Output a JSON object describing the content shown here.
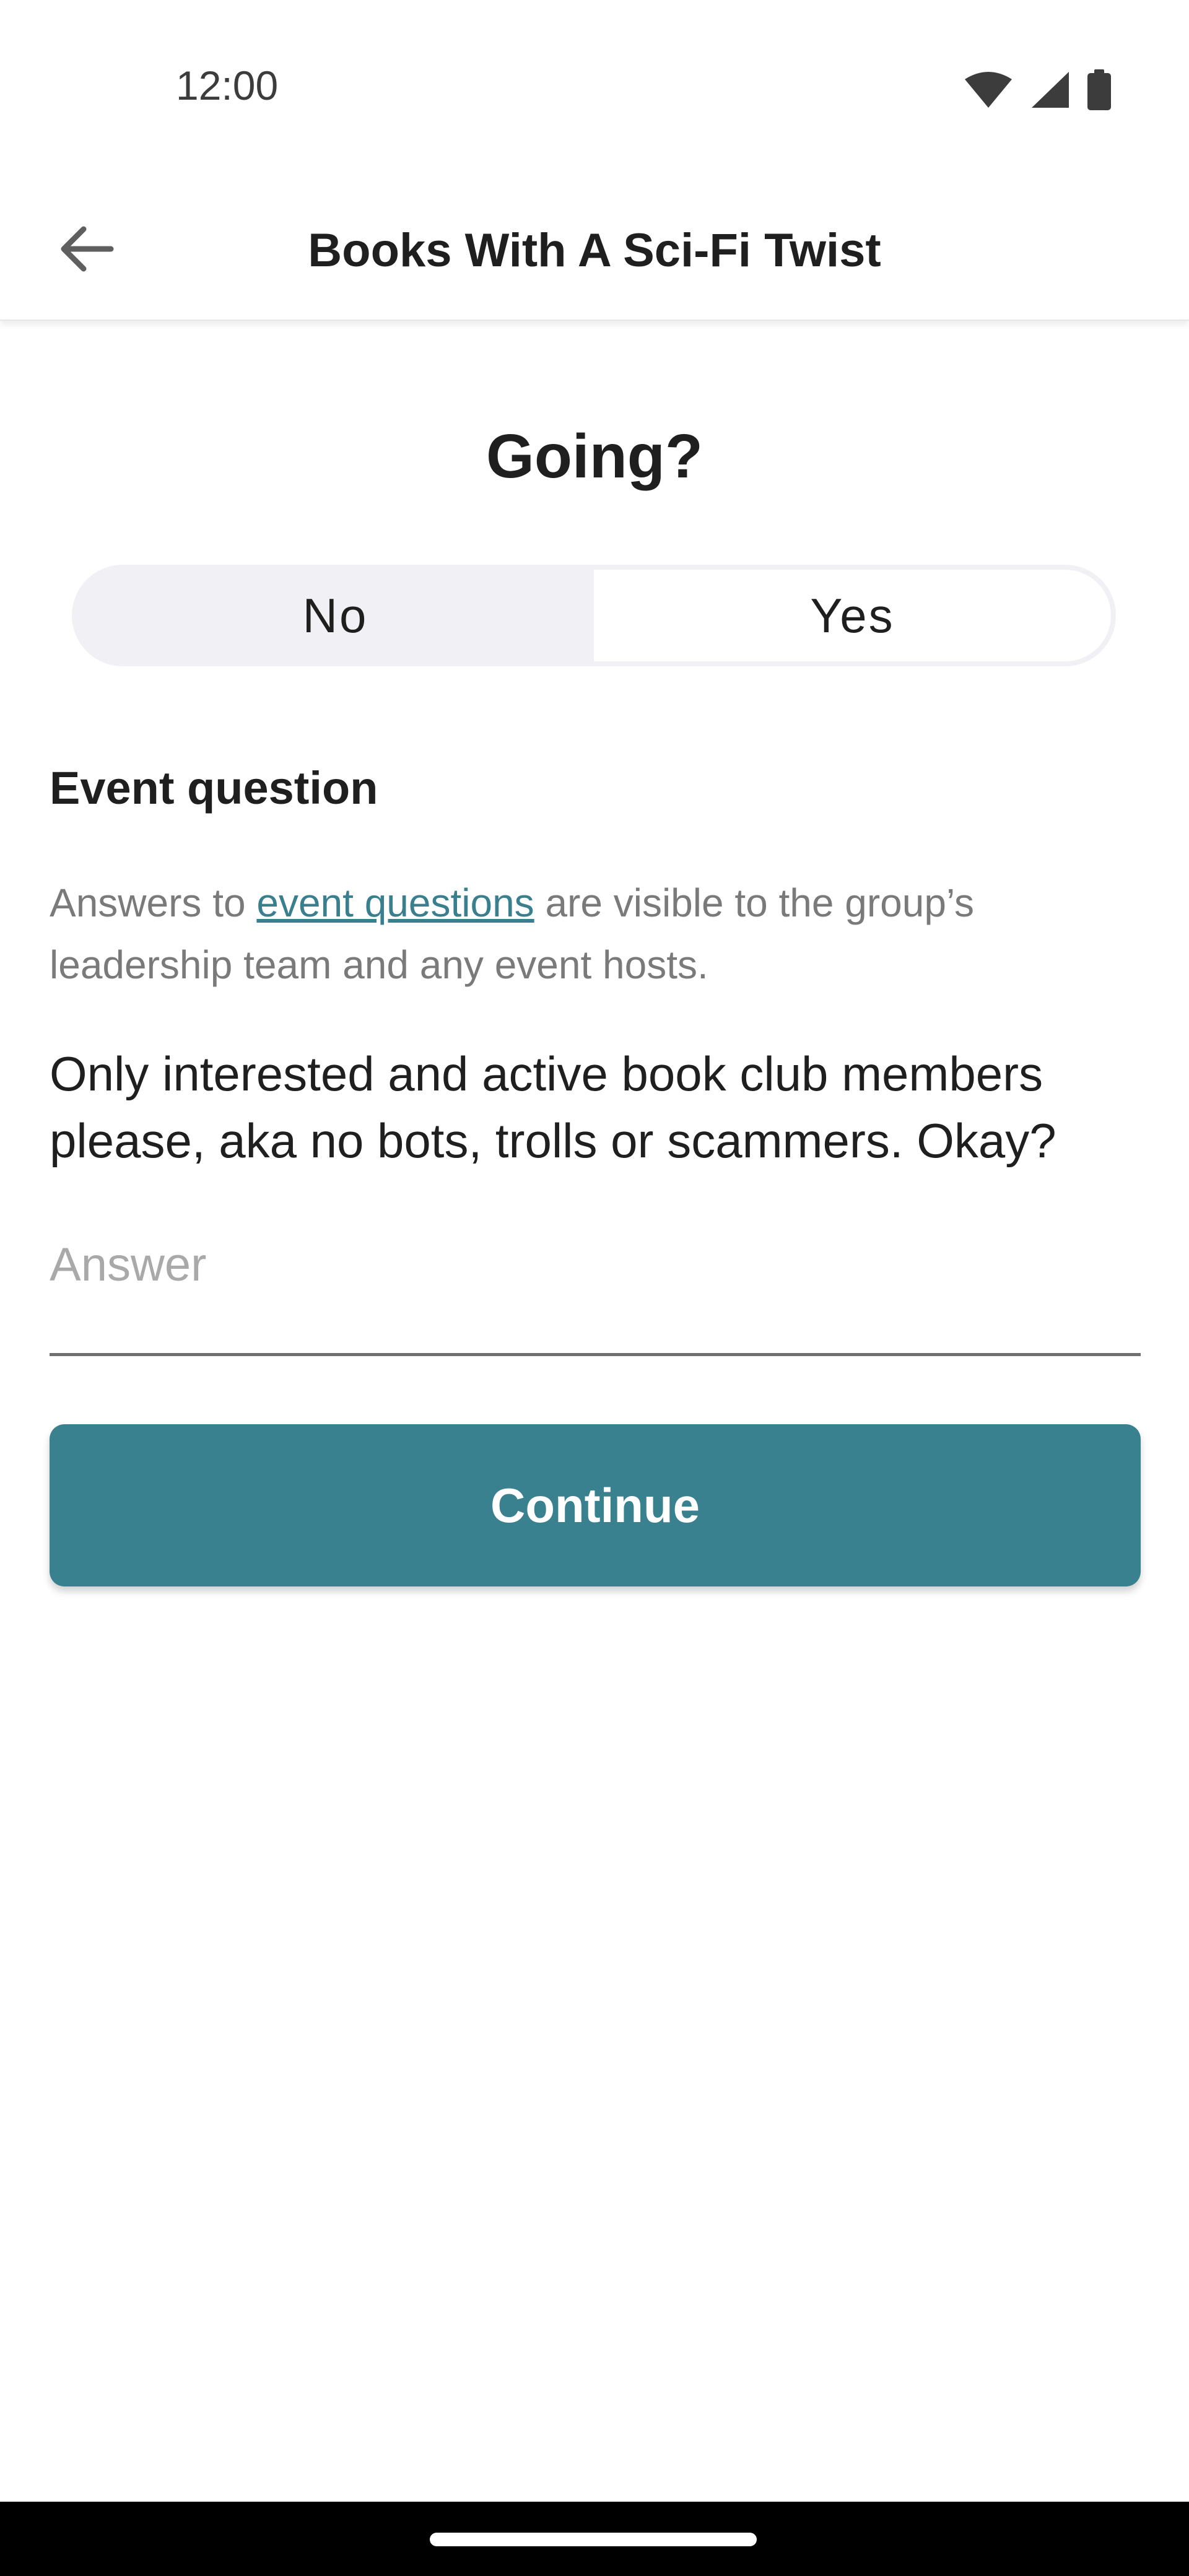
{
  "status_bar": {
    "time": "12:00",
    "icons": [
      "wifi-icon",
      "cellular-signal-icon",
      "battery-icon"
    ]
  },
  "app_bar": {
    "back_icon": "arrow-back-icon",
    "title": "Books With A Sci-Fi Twist"
  },
  "rsvp": {
    "heading": "Going?",
    "options": [
      {
        "label": "No",
        "selected": false
      },
      {
        "label": "Yes",
        "selected": true
      }
    ]
  },
  "event_question": {
    "heading": "Event question",
    "info_prefix": "Answers to ",
    "info_link": "event questions",
    "info_suffix": " are visible to the group’s leadership team and any event hosts.",
    "question": "Only interested and active book club members please, aka no bots, trolls or scammers. Okay?",
    "answer_value": "",
    "answer_placeholder": "Answer"
  },
  "continue_label": "Continue",
  "colors": {
    "accent": "#3a8190",
    "link": "#3a7f8e",
    "segment_bg": "#f0f0f5"
  }
}
